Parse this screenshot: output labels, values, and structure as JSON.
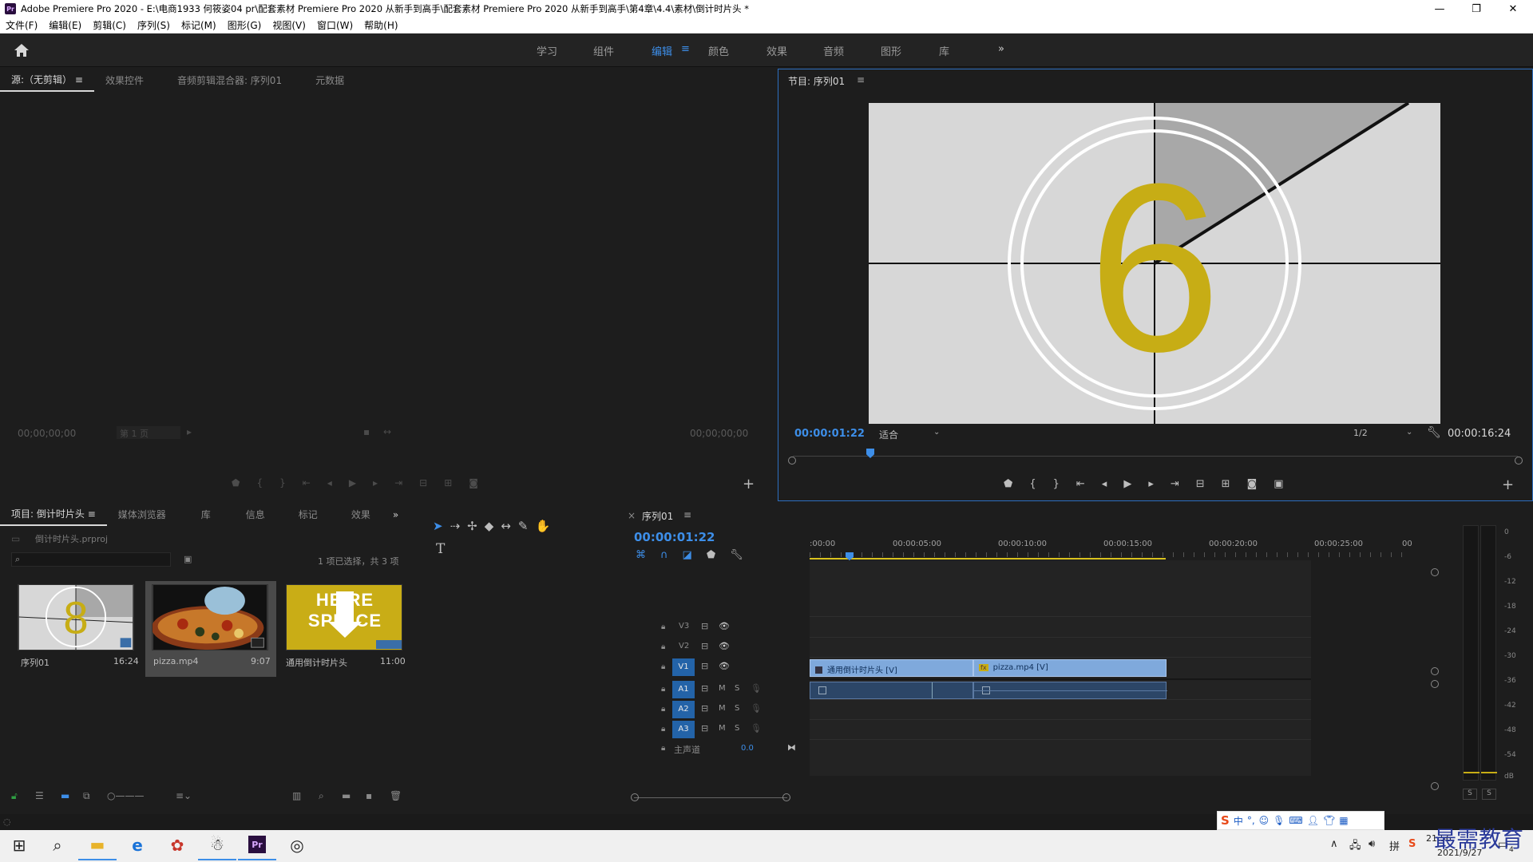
{
  "window": {
    "app_icon": "Pr",
    "title": "Adobe Premiere Pro 2020 - E:\\电商1933 何筱姿04 pr\\配套素材 Premiere Pro 2020 从新手到高手\\配套素材 Premiere Pro 2020 从新手到高手\\第4章\\4.4\\素材\\倒计时片头 *",
    "minimize": "—",
    "restore": "❐",
    "close": "✕"
  },
  "menu": [
    "文件(F)",
    "编辑(E)",
    "剪辑(C)",
    "序列(S)",
    "标记(M)",
    "图形(G)",
    "视图(V)",
    "窗口(W)",
    "帮助(H)"
  ],
  "workspaces": [
    "学习",
    "组件",
    "编辑",
    "颜色",
    "效果",
    "音频",
    "图形",
    "库"
  ],
  "workspace_active": "编辑",
  "workspace_menu_glyph": "≡",
  "workspace_more": "»",
  "source_panel": {
    "tabs": [
      "源:（无剪辑）",
      "效果控件",
      "音频剪辑混合器: 序列01",
      "元数据"
    ],
    "tab_menu_glyph": "≡",
    "timecode_left": "00;00;00;00",
    "page_select": "第 1 页",
    "timecode_right": "00;00;00;00"
  },
  "program_panel": {
    "title": "节目: 序列01",
    "menu_glyph": "≡",
    "timecode": "00:00:01:22",
    "fit": "适合",
    "quality": "1/2",
    "duration": "00:00:16:24",
    "countdown_number": "6",
    "colors": {
      "frame_bg": "#d7d7d7",
      "wedge": "#a8a8a8",
      "number": "#c7ad15",
      "playhead": "#3d8ee8"
    }
  },
  "project_panel": {
    "tabs": [
      "项目: 倒计时片头",
      "媒体浏览器",
      "库",
      "信息",
      "标记",
      "效果"
    ],
    "tab_menu_glyph": "≡",
    "more": "»",
    "project_file": "倒计时片头.prproj",
    "selection_status": "1 项已选择，共 3 项",
    "items": [
      {
        "name": "序列01",
        "duration": "16:24",
        "thumb_number": "8"
      },
      {
        "name": "pizza.mp4",
        "duration": "9:07"
      },
      {
        "name": "通用倒计时片头",
        "duration": "11:00",
        "thumb_text_top": "HE RE",
        "thumb_text_bottom": "SPL ICE"
      }
    ]
  },
  "tools": [
    "selection",
    "track-select",
    "ripple-edit",
    "razor",
    "slip",
    "pen",
    "hand",
    "type"
  ],
  "timeline": {
    "close_glyph": "×",
    "sequence": "序列01",
    "menu_glyph": "≡",
    "timecode": "00:00:01:22",
    "ruler": [
      ":00:00",
      "00:00:05:00",
      "00:00:10:00",
      "00:00:15:00",
      "00:00:20:00",
      "00:00:25:00",
      "00"
    ],
    "video_tracks": [
      "V3",
      "V2",
      "V1"
    ],
    "audio_tracks": [
      "A1",
      "A2",
      "A3"
    ],
    "track_buttons": {
      "mute": "M",
      "solo": "S"
    },
    "master_label": "主声道",
    "master_value": "0.0",
    "clips": {
      "v1_clip1": "通用倒计时片头 [V]",
      "v1_clip2": "pizza.mp4 [V]",
      "fx_badge": "fx"
    }
  },
  "audio_meter": {
    "scale": [
      "0",
      "-6",
      "-12",
      "-18",
      "-24",
      "-30",
      "-36",
      "-42",
      "-48",
      "-54",
      "dB"
    ],
    "solo_buttons": [
      "S",
      "S"
    ]
  },
  "taskbar": {
    "time": "21:56",
    "date": "2021/9/27",
    "notification_count": "4",
    "ime_label": "中",
    "watermark": "最需教育"
  }
}
